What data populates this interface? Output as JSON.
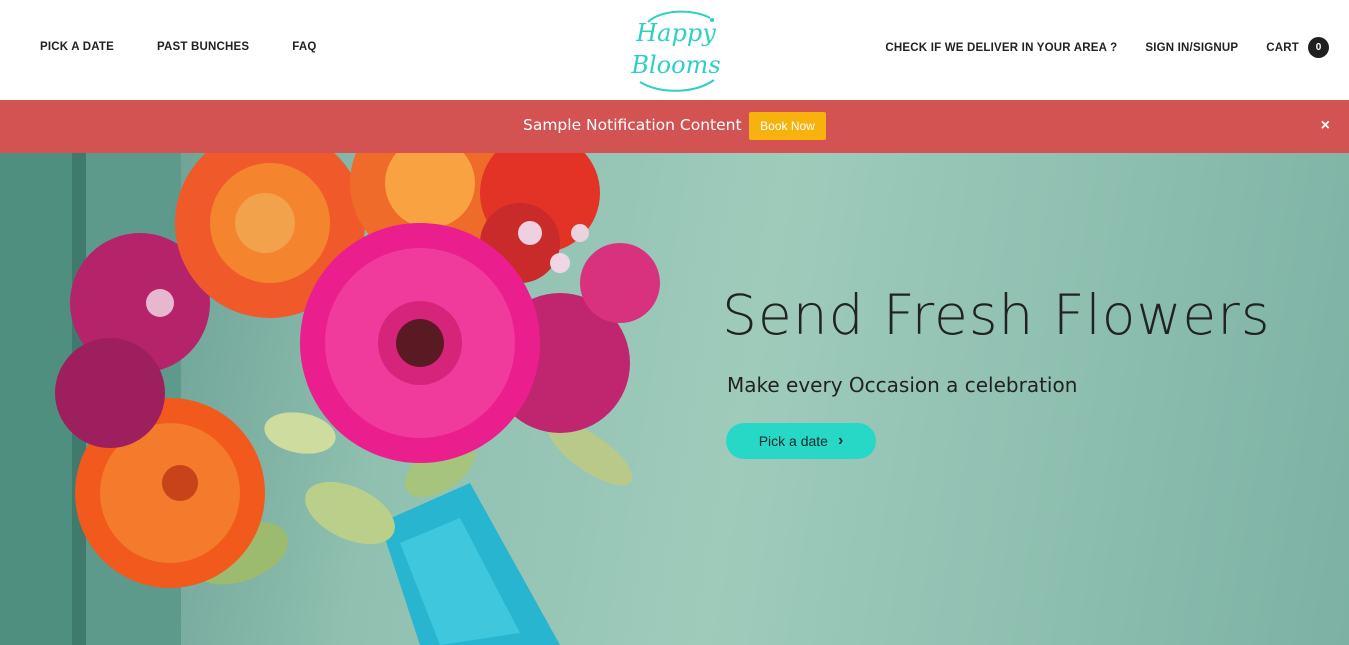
{
  "header": {
    "nav_left": [
      "PICK A DATE",
      "PAST BUNCHES",
      "FAQ"
    ],
    "logo_text_line1": "Happy",
    "logo_text_line2": "Blooms",
    "nav_right": [
      "CHECK IF WE DELIVER IN YOUR AREA ?",
      "SIGN IN/SIGNUP"
    ],
    "cart_label": "CART",
    "cart_count": "0"
  },
  "notification": {
    "text": "Sample Notification Content",
    "button_label": "Book Now",
    "close_symbol": "×",
    "background_color": "#d25352",
    "button_color": "#f7b20d"
  },
  "hero": {
    "title": "Send Fresh Flowers",
    "subtitle": "Make every Occasion a celebration",
    "cta_label": "Pick a date",
    "cta_icon": "chevron-right-icon",
    "cta_color": "#27d8c6"
  },
  "colors": {
    "logo": "#2ecfc4",
    "text_dark": "#222222"
  }
}
